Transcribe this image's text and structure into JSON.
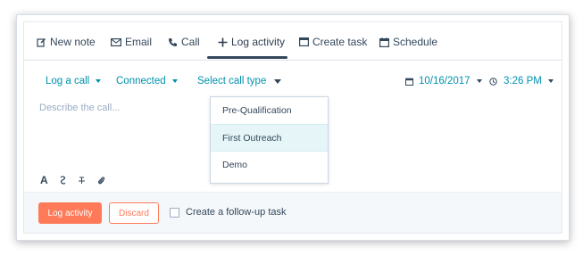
{
  "tabs": [
    {
      "label": "New note",
      "icon": "edit-icon"
    },
    {
      "label": "Email",
      "icon": "mail-icon"
    },
    {
      "label": "Call",
      "icon": "phone-icon"
    },
    {
      "label": "Log activity",
      "icon": "plus-icon"
    },
    {
      "label": "Create task",
      "icon": "task-icon"
    },
    {
      "label": "Schedule",
      "icon": "calendar-icon"
    }
  ],
  "active_tab": "Log activity",
  "options": {
    "activity_type": "Log a call",
    "outcome": "Connected",
    "call_type": "Select call type",
    "date": "10/16/2017",
    "time": "3:26 PM"
  },
  "editor": {
    "placeholder": "Describe the call..."
  },
  "call_type_menu": {
    "items": [
      "Pre-Qualification",
      "First Outreach",
      "Demo"
    ],
    "highlighted": "First Outreach"
  },
  "format_toolbar": {
    "bold": "A",
    "icons": [
      "text-style-icon",
      "strikethrough-icon",
      "insert-icon",
      "attachment-icon"
    ]
  },
  "footer": {
    "primary_button": "Log activity",
    "secondary_button": "Discard",
    "followup_label": "Create a follow-up task",
    "followup_checked": false
  },
  "colors": {
    "accent": "#ff7a59",
    "link": "#0091ae",
    "text": "#33475b",
    "highlight": "#e5f5f8"
  }
}
